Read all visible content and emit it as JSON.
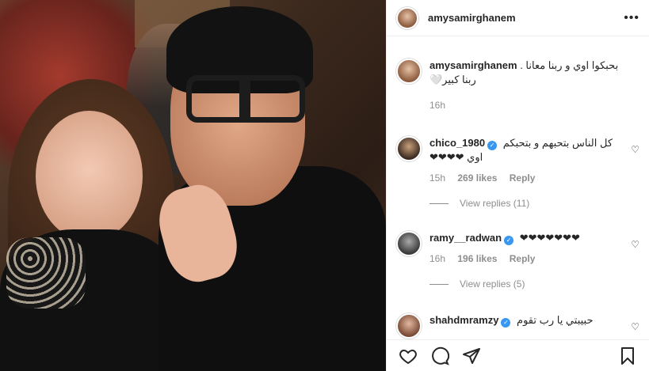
{
  "header": {
    "username": "amysamirghanem",
    "more_label": "•••"
  },
  "caption": {
    "username": "amysamirghanem",
    "text": "بحبكوا اوي و ربنا معانا . ربنا كبير🤍",
    "time": "16h"
  },
  "comments": [
    {
      "username": "chico_1980",
      "verified": true,
      "text": "كل الناس بتحبهم و بتحبكم اوي ❤❤❤❤",
      "time": "15h",
      "likes": "269 likes",
      "reply_label": "Reply",
      "replies": "View replies (11)"
    },
    {
      "username": "ramy__radwan",
      "verified": true,
      "text": "❤❤❤❤❤❤❤",
      "time": "16h",
      "likes": "196 likes",
      "reply_label": "Reply",
      "replies": "View replies (5)"
    },
    {
      "username": "shahdmramzy",
      "verified": true,
      "text": "حبيبتي يا رب تقوم"
    }
  ],
  "actions": {
    "like": "heart-icon",
    "comment": "comment-icon",
    "share": "share-icon",
    "save": "bookmark-icon"
  }
}
